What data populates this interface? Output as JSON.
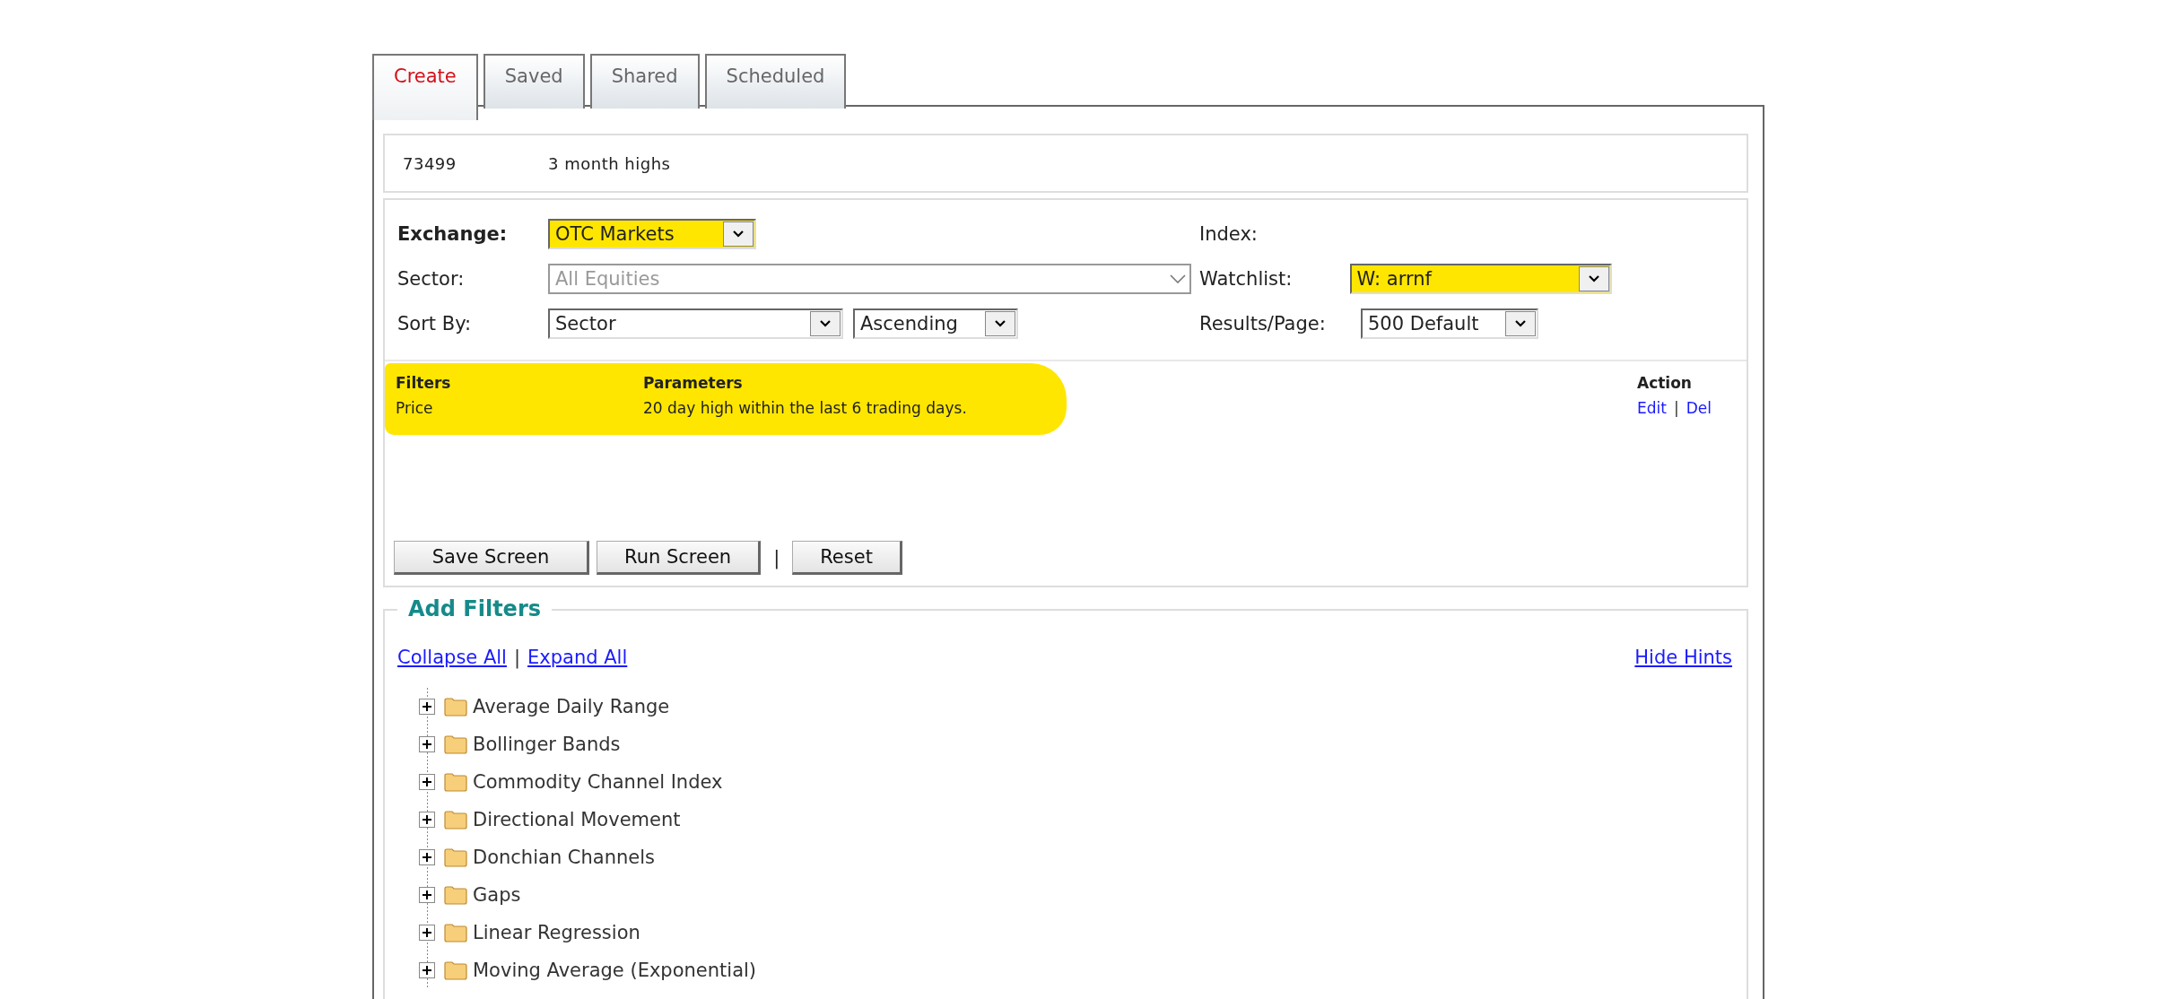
{
  "tabs": [
    {
      "label": "Create",
      "selected": true
    },
    {
      "label": "Saved",
      "selected": false
    },
    {
      "label": "Shared",
      "selected": false
    },
    {
      "label": "Scheduled",
      "selected": false
    }
  ],
  "screen": {
    "id": "73499",
    "name": "3 month highs"
  },
  "exchange": {
    "label": "Exchange:",
    "value": "OTC Markets",
    "highlighted": true
  },
  "sector": {
    "label": "Sector:",
    "placeholder": "All Equities"
  },
  "sort_by": {
    "label": "Sort By:",
    "value": "Sector",
    "order": "Ascending"
  },
  "index": {
    "label": "Index:"
  },
  "watchlist": {
    "label": "Watchlist:",
    "value": "W: arrnf",
    "highlighted": true
  },
  "results_per_page": {
    "label": "Results/Page:",
    "value": "500 Default"
  },
  "filters_table": {
    "highlighted": true,
    "columns": [
      "Filters",
      "Parameters",
      "Action"
    ],
    "rows": [
      {
        "filter": "Price",
        "parameters": "20 day high within the last 6 trading days.",
        "actions": [
          {
            "kind": "link",
            "label": "Edit"
          },
          {
            "kind": "separator",
            "label": "|"
          },
          {
            "kind": "link",
            "label": "Del"
          }
        ]
      }
    ]
  },
  "buttons": [
    {
      "kind": "button",
      "label": "Save Screen"
    },
    {
      "kind": "button",
      "label": "Run Screen"
    },
    {
      "kind": "separator",
      "label": "|"
    },
    {
      "kind": "button",
      "label": "Reset"
    }
  ],
  "add_filters": {
    "title": "Add Filters",
    "links": [
      {
        "kind": "link",
        "label": "Collapse All"
      },
      {
        "kind": "separator",
        "label": "|"
      },
      {
        "kind": "link",
        "label": "Expand All"
      }
    ],
    "hint_link": "Hide Hints",
    "tree": [
      {
        "label": "Average Daily Range",
        "expanded": false
      },
      {
        "label": "Bollinger Bands",
        "expanded": false
      },
      {
        "label": "Commodity Channel Index",
        "expanded": false
      },
      {
        "label": "Directional Movement",
        "expanded": false
      },
      {
        "label": "Donchian Channels",
        "expanded": false
      },
      {
        "label": "Gaps",
        "expanded": false
      },
      {
        "label": "Linear Regression",
        "expanded": false
      },
      {
        "label": "Moving Average (Exponential)",
        "expanded": false
      }
    ]
  }
}
